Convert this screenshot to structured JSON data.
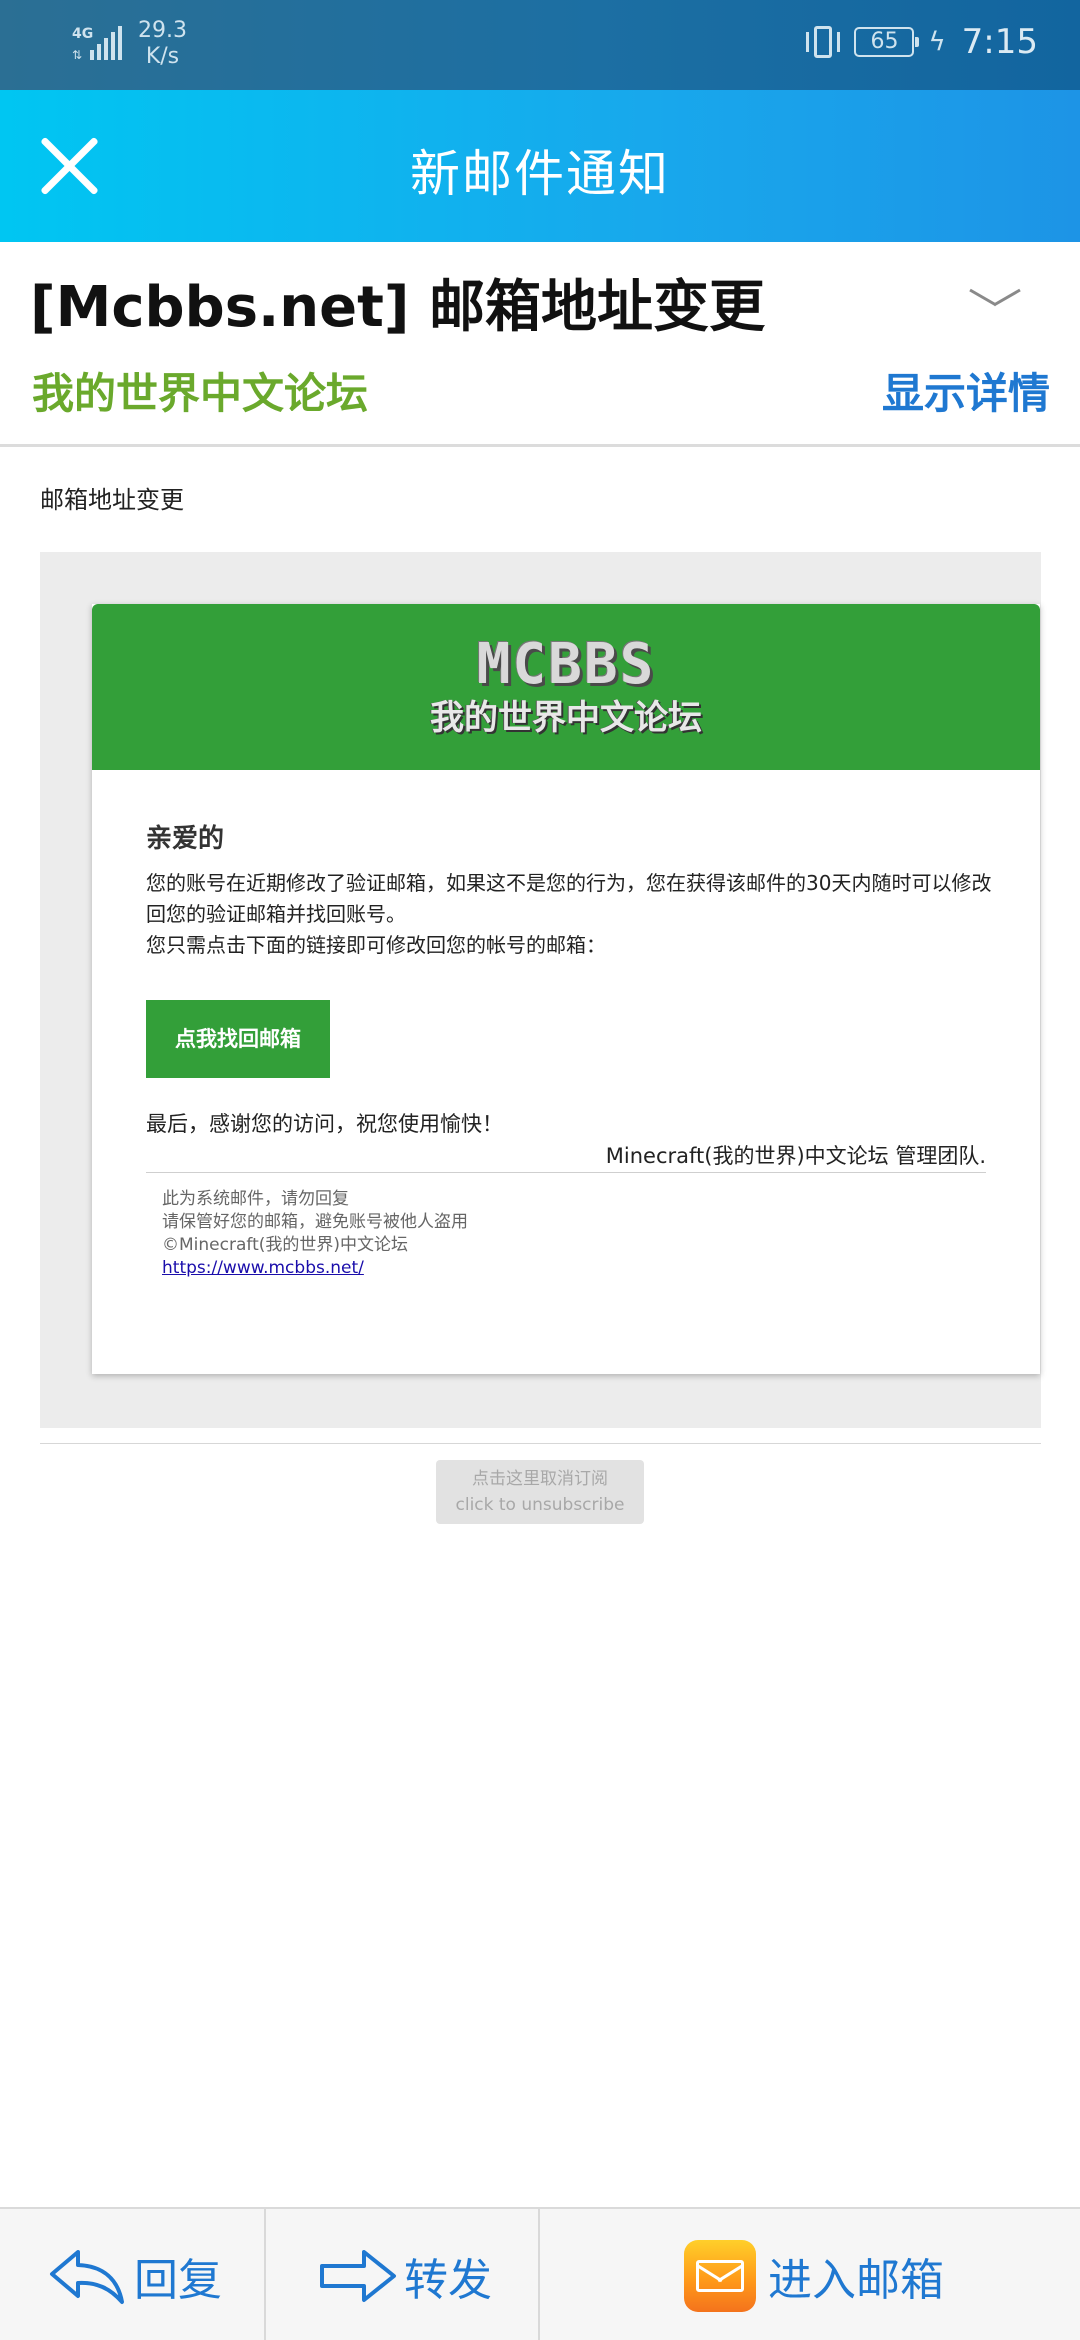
{
  "status_bar": {
    "network": "4G",
    "speed_value": "29.3",
    "speed_unit": "K/s",
    "battery": "65",
    "time": "7:15"
  },
  "app_bar": {
    "title": "新邮件通知",
    "close_icon": "close-icon"
  },
  "mail": {
    "subject": "[Mcbbs.net] 邮箱地址变更",
    "sender": "我的世界中文论坛",
    "show_details": "显示详情",
    "intro": "邮箱地址变更"
  },
  "email_card": {
    "logo_top": "MCBBS",
    "logo_bottom": "我的世界中文论坛",
    "greeting": "亲爱的",
    "para_line1": "您的账号在近期修改了验证邮箱，如果这不是您的行为，您在获得该邮件的30天内随时可以修改回您的验证邮箱并找回账号。",
    "para_line2": "您只需点击下面的链接即可修改回您的帐号的邮箱：",
    "button_label": "点我找回邮箱",
    "closing": "最后，感谢您的访问，祝您使用愉快！",
    "team": "Minecraft(我的世界)中文论坛 管理团队.",
    "footnote_1": "此为系统邮件，请勿回复",
    "footnote_2": "请保管好您的邮箱，避免账号被他人盗用",
    "footnote_3": "©Minecraft(我的世界)中文论坛",
    "footnote_link": "https://www.mcbbs.net/"
  },
  "unsubscribe": {
    "line_cn": "点击这里取消订阅",
    "line_en": "click to unsubscribe"
  },
  "toolbar": {
    "reply": "回复",
    "forward": "转发",
    "open_mailbox": "进入邮箱"
  },
  "colors": {
    "app_bar": "#18a8ec",
    "sender_green": "#6aa92c",
    "link_blue": "#1f78d1",
    "card_green": "#339f39"
  }
}
